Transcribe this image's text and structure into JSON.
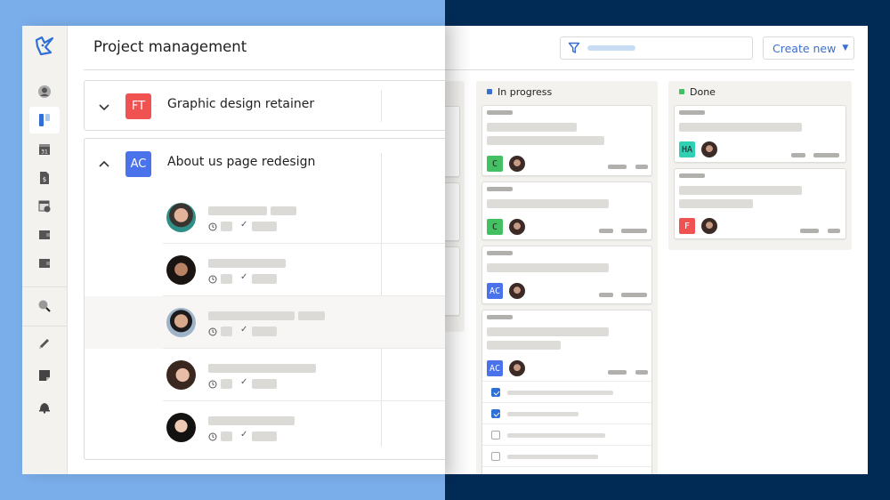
{
  "app": {
    "title": "Project management"
  },
  "colors": {
    "background_left": "#7aaeea",
    "background_right": "#012a55",
    "accent": "#3a6fd0",
    "in_progress_dot": "#3a6fd0",
    "done_dot": "#43c162",
    "orange_flag": "#f28a1f"
  },
  "sidebar": {
    "items": [
      {
        "name": "logo",
        "icon": "app-logo-icon"
      },
      {
        "name": "profile",
        "icon": "user-circle-icon"
      },
      {
        "name": "projects",
        "icon": "board-icon",
        "active": true
      },
      {
        "name": "calendar",
        "icon": "calendar-icon",
        "label": "31"
      },
      {
        "name": "invoices",
        "icon": "invoice-icon",
        "label": "$"
      },
      {
        "name": "timesheet",
        "icon": "clock-calendar-icon"
      },
      {
        "name": "wallet",
        "icon": "wallet-icon"
      },
      {
        "name": "wallet-2",
        "icon": "wallet-icon"
      },
      {
        "name": "search",
        "icon": "search-icon"
      },
      {
        "name": "tasks",
        "icon": "pencil-icon"
      },
      {
        "name": "notes",
        "icon": "note-icon"
      },
      {
        "name": "notifications",
        "icon": "bell-icon"
      }
    ]
  },
  "projects": [
    {
      "badge": "FT",
      "badge_color": "#f05252",
      "name": "Graphic design retainer",
      "expanded": false
    },
    {
      "badge": "AC",
      "badge_color": "#4a72ea",
      "name": "About us page redesign",
      "expanded": true,
      "members": [
        {
          "avatar": "avatar-man-glasses",
          "flag": false,
          "highlighted": false
        },
        {
          "avatar": "avatar-woman-dark-hair",
          "flag": false,
          "highlighted": false
        },
        {
          "avatar": "avatar-man",
          "flag": true,
          "highlighted": true
        },
        {
          "avatar": "avatar-woman-bangs",
          "flag": false,
          "highlighted": false
        },
        {
          "avatar": "avatar-woman-glasses",
          "flag": true,
          "highlighted": false
        }
      ]
    }
  ],
  "board": {
    "filter": {
      "icon": "filter-icon",
      "placeholder": ""
    },
    "create_new": {
      "label": "Create new",
      "icon": "caret-down-icon",
      "caret": "▼"
    },
    "columns": [
      {
        "title": "In progress",
        "cards": [
          {
            "badge": "C",
            "badge_color": "#43c162"
          },
          {
            "badge": "C",
            "badge_color": "#43c162"
          },
          {
            "badge": "AC",
            "badge_color": "#4a72ea"
          },
          {
            "badge": "AC",
            "badge_color": "#4a72ea",
            "checklist": [
              true,
              true,
              false,
              false
            ]
          }
        ]
      },
      {
        "title": "Done",
        "cards": [
          {
            "badge": "HA",
            "badge_color": "#2fd0b4"
          },
          {
            "badge": "F",
            "badge_color": "#f05252"
          }
        ]
      }
    ]
  },
  "glyphs": {
    "check": "✓"
  }
}
